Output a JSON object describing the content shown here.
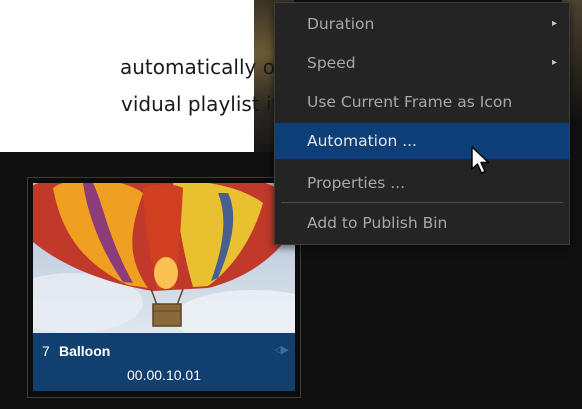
{
  "doc": {
    "line1": "automatically on",
    "line2": "vidual playlist item."
  },
  "context_menu": {
    "items": [
      {
        "label": "Duration",
        "submenu": true
      },
      {
        "label": "Speed",
        "submenu": true
      },
      {
        "label": "Use Current Frame as Icon",
        "submenu": false
      },
      {
        "label": "Automation ...",
        "submenu": false,
        "selected": true
      },
      {
        "label": "Properties ...",
        "submenu": false
      },
      {
        "label": "Add to Publish Bin",
        "submenu": false
      }
    ],
    "submenu_glyph": "▸",
    "selected_color": "#0c3e78"
  },
  "playlist_item": {
    "index": "7",
    "title": "Balloon",
    "duration": "00.00.10.01",
    "info_color": "#12406e",
    "thumbnail": "hot-air-balloon-photo"
  },
  "icons": {
    "cursor": "mouse-pointer-icon",
    "flag": "automation-flag-icon"
  }
}
